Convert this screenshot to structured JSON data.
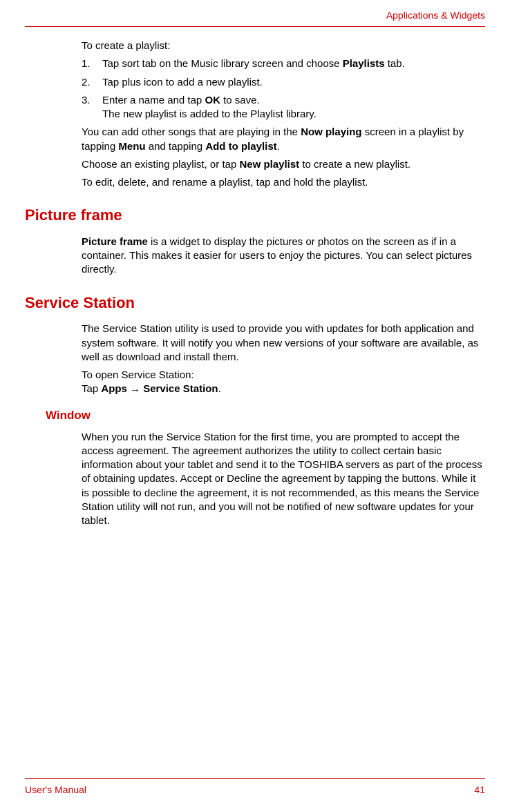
{
  "header": {
    "title": "Applications & Widgets"
  },
  "intro": {
    "p1": "To create a playlist:"
  },
  "steps": {
    "n1": "1.",
    "t1a": "Tap sort tab on the Music library screen and choose ",
    "t1b": "Playlists",
    "t1c": " tab.",
    "n2": "2.",
    "t2": "Tap plus icon to add a new playlist.",
    "n3": "3.",
    "t3a": "Enter a name and tap ",
    "t3b": "OK",
    "t3c": " to save.",
    "t3d": "The new playlist is added to the Playlist library."
  },
  "after": {
    "p1a": "You can add other songs that are playing in the ",
    "p1b": "Now playing",
    "p1c": " screen in a playlist by tapping ",
    "p1d": "Menu",
    "p1e": " and tapping ",
    "p1f": "Add to playlist",
    "p1g": ".",
    "p2a": "Choose an existing playlist, or tap ",
    "p2b": "New playlist",
    "p2c": " to create a new playlist.",
    "p3": "To edit, delete, and rename a playlist, tap and hold the playlist."
  },
  "pictureFrame": {
    "heading": "Picture frame",
    "p1a": "Picture frame",
    "p1b": " is a widget to display the pictures or photos on the screen as if in a container. This makes it easier for users to enjoy the pictures. You can select pictures directly."
  },
  "serviceStation": {
    "heading": "Service Station",
    "p1": "The Service Station utility is used to provide you with updates for both application and system software. It will notify you when new versions of your software are available, as well as download and install them.",
    "p2": "To open Service Station:",
    "p3a": "Tap ",
    "p3b": "Apps",
    "p3c": " → ",
    "p3d": "Service Station",
    "p3e": "."
  },
  "window": {
    "heading": "Window",
    "p1": "When you run the Service Station for the first time, you are prompted to accept the access agreement. The agreement authorizes the utility to collect certain basic information about your tablet and send it to the TOSHIBA servers as part of the process of obtaining updates. Accept or Decline the agreement by tapping the buttons. While it is possible to decline the agreement, it is not recommended, as this means the Service Station utility will not run, and you will not be notified of new software updates for your tablet."
  },
  "footer": {
    "left": "User's Manual",
    "right": "41"
  }
}
